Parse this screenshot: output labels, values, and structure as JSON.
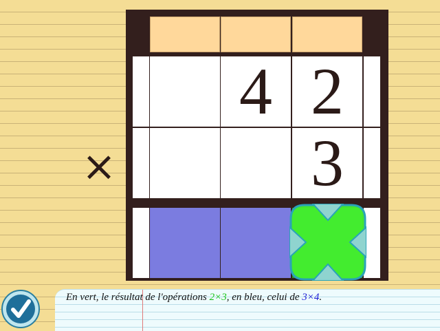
{
  "operator": "×",
  "grid": {
    "carry_row": [
      "",
      "",
      ""
    ],
    "multiplicand_row": [
      "",
      "4",
      "2"
    ],
    "multiplier_row": [
      "",
      "",
      "3"
    ],
    "result_row": [
      "",
      "",
      ""
    ]
  },
  "result_highlights": [
    "blue",
    "blue",
    "green"
  ],
  "colors": {
    "background": "#f4dd95",
    "board": "#331f1d",
    "carry": "#ffd89b",
    "blue_result": "#7b7ce0",
    "green_result": "#44f02f",
    "cursor_frame": "#2aa3b8",
    "green_text": "#17c317",
    "blue_text": "#1a1ad6"
  },
  "instruction": {
    "prefix": "En vert, le résultat de l'opérations ",
    "green_term": "2×3",
    "middle": ", en bleu, celui de ",
    "blue_term": "3×4",
    "suffix": "."
  },
  "icons": {
    "check_button": "check-icon",
    "cursor": "move-cursor-icon"
  }
}
